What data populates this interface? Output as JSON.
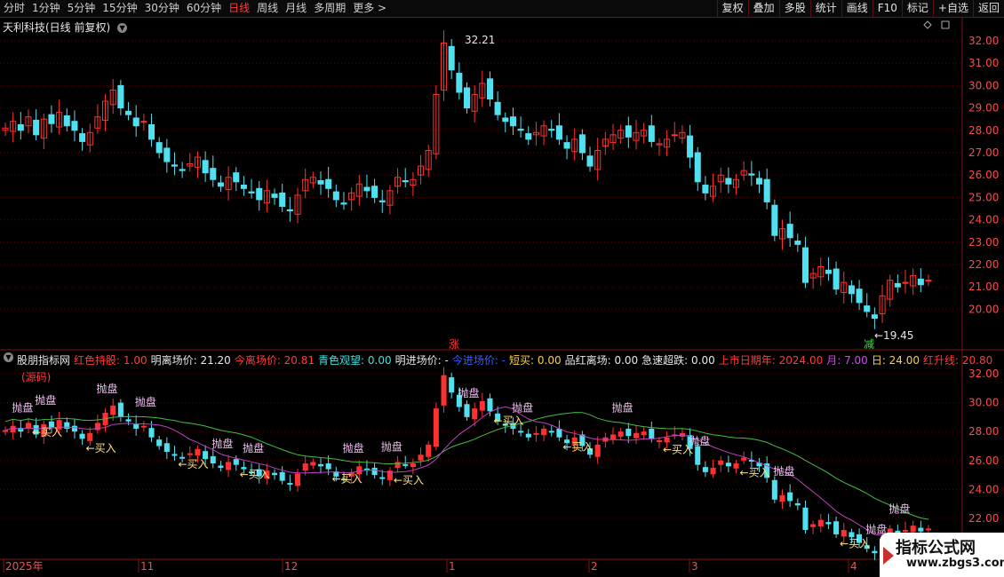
{
  "toolbar": {
    "periods": [
      "分时",
      "1分钟",
      "5分钟",
      "15分钟",
      "30分钟",
      "60分钟",
      "日线",
      "周线",
      "月线",
      "多周期",
      "更多 >"
    ],
    "active_index": 6,
    "buttons": [
      "复权",
      "叠加",
      "多股",
      "统计",
      "画线",
      "F10",
      "标记",
      "+自选",
      "返回"
    ]
  },
  "stock": {
    "title": "天利科技(日线 前复权)",
    "high_label": "32.21",
    "low_label": "19.45",
    "rise_marker": "涨",
    "fall_marker": "减"
  },
  "indicator": {
    "name": "股朋指标网",
    "source_label": "(源码)",
    "params": [
      {
        "label": "红色持股:",
        "value": "1.00",
        "color": "#ff3b3b"
      },
      {
        "label": "明离场价:",
        "value": "21.20",
        "color": "#e8e8e8"
      },
      {
        "label": "今离场价:",
        "value": "20.81",
        "color": "#ff3b3b"
      },
      {
        "label": "青色观望:",
        "value": "0.00",
        "color": "#40e0e0"
      },
      {
        "label": "明进场价:",
        "value": "-",
        "color": "#e8e8e8"
      },
      {
        "label": "今进场价:",
        "value": "-",
        "color": "#3a5cff"
      },
      {
        "label": "短买:",
        "value": "0.00",
        "color": "#ffd040"
      },
      {
        "label": "品红离场:",
        "value": "0.00",
        "color": "#e8e8e8"
      },
      {
        "label": "急速超跌:",
        "value": "0.00",
        "color": "#e8e8e8"
      },
      {
        "label": "上市日期年:",
        "value": "2024.00",
        "color": "#ff3b3b"
      },
      {
        "label": "月:",
        "value": "7.00",
        "color": "#e040ff"
      },
      {
        "label": "日:",
        "value": "24.00",
        "color": "#ffd040"
      },
      {
        "label": "红升线:",
        "value": "20.80",
        "color": "#ff3b3b"
      }
    ],
    "sell_label": "抛盘",
    "buy_label": "买入"
  },
  "price_axis": [
    "32.00",
    "31.00",
    "30.00",
    "29.00",
    "28.00",
    "27.00",
    "26.00",
    "25.00",
    "24.00",
    "23.00",
    "22.00",
    "21.00",
    "20.00"
  ],
  "indicator_axis": [
    "32.00",
    "30.00",
    "28.00",
    "26.00",
    "24.00",
    "22.00"
  ],
  "date_axis": [
    "2025年",
    "11",
    "12",
    "1",
    "2",
    "3",
    "4"
  ],
  "watermark": {
    "line1": "指标公式网",
    "line2": "www.zbgs3.com"
  },
  "colors": {
    "up": "#ff3030",
    "down": "#50e0f0",
    "grid": "#5a0000",
    "axis": "#ff4a4a",
    "ma_green": "#40c040",
    "ma_magenta": "#c040c0"
  }
}
